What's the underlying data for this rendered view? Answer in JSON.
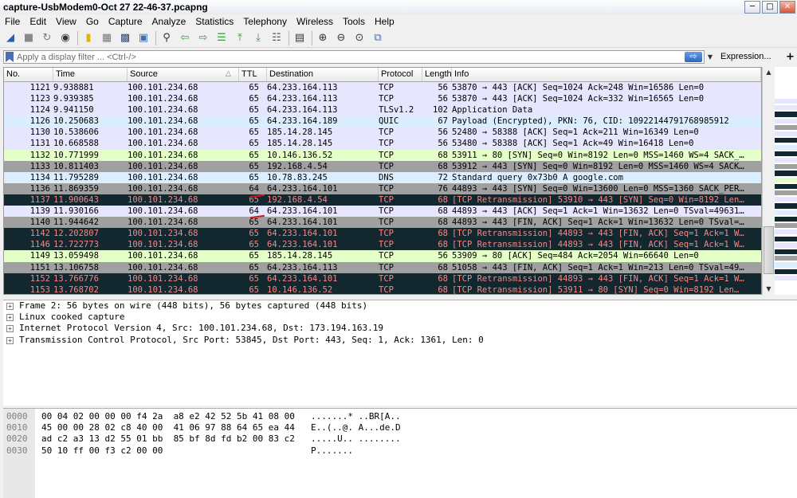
{
  "window": {
    "title": "capture-UsbModem0-Oct 27 22-46-37.pcapng",
    "btn_min": "─",
    "btn_max": "□",
    "btn_close": "✕"
  },
  "menu": [
    "File",
    "Edit",
    "View",
    "Go",
    "Capture",
    "Analyze",
    "Statistics",
    "Telephony",
    "Wireless",
    "Tools",
    "Help"
  ],
  "toolbar": {
    "groups": [
      [
        {
          "name": "start-capture-icon",
          "glyph": "◢",
          "color": "#2a5bb5"
        },
        {
          "name": "stop-capture-icon",
          "glyph": "■",
          "color": "#8a8a8a"
        },
        {
          "name": "restart-capture-icon",
          "glyph": "↻",
          "color": "#7a7a7a"
        },
        {
          "name": "capture-options-icon",
          "glyph": "◉",
          "color": "#333333"
        }
      ],
      [
        {
          "name": "open-file-icon",
          "glyph": "▮",
          "color": "#e3b400"
        },
        {
          "name": "save-file-icon",
          "glyph": "▦",
          "color": "#777777"
        },
        {
          "name": "close-file-icon",
          "glyph": "▩",
          "color": "#304a77"
        },
        {
          "name": "reload-file-icon",
          "glyph": "▣",
          "color": "#3f6fb0"
        }
      ],
      [
        {
          "name": "find-packet-icon",
          "glyph": "⚲",
          "color": "#333333"
        },
        {
          "name": "go-back-icon",
          "glyph": "⇦",
          "color": "#3a9a3a"
        },
        {
          "name": "go-forward-icon",
          "glyph": "⇨",
          "color": "#3a9a3a"
        },
        {
          "name": "go-to-packet-icon",
          "glyph": "☰",
          "color": "#3a9a3a"
        },
        {
          "name": "go-first-icon",
          "glyph": "⤒",
          "color": "#3a9a3a"
        },
        {
          "name": "go-last-icon",
          "glyph": "⤓",
          "color": "#3a9a3a"
        },
        {
          "name": "autoscroll-icon",
          "glyph": "☷",
          "color": "#555555"
        }
      ],
      [
        {
          "name": "colorize-icon",
          "glyph": "▤",
          "color": "#333333"
        }
      ],
      [
        {
          "name": "zoom-in-icon",
          "glyph": "⊕",
          "color": "#333333"
        },
        {
          "name": "zoom-out-icon",
          "glyph": "⊖",
          "color": "#333333"
        },
        {
          "name": "zoom-normal-icon",
          "glyph": "⊙",
          "color": "#333333"
        },
        {
          "name": "resize-columns-icon",
          "glyph": "⧉",
          "color": "#3f6fb0"
        }
      ]
    ]
  },
  "filter": {
    "placeholder": "Apply a display filter ... <Ctrl-/>",
    "apply_glyph": "⇨",
    "dropdown_glyph": "▼",
    "expression_label": "Expression...",
    "plus": "+"
  },
  "columns": [
    {
      "key": "no",
      "label": "No."
    },
    {
      "key": "time",
      "label": "Time"
    },
    {
      "key": "source",
      "label": "Source"
    },
    {
      "key": "ttl",
      "label": "TTL"
    },
    {
      "key": "destination",
      "label": "Destination"
    },
    {
      "key": "protocol",
      "label": "Protocol"
    },
    {
      "key": "length",
      "label": "Length"
    },
    {
      "key": "info",
      "label": "Info"
    }
  ],
  "sort_arrow": "△",
  "colors": {
    "tcp": "#e7e6ff",
    "udp": "#daeeff",
    "syn": "#a0a0a0",
    "fin": "#a0a0a0",
    "bad": "#12272e",
    "bad_text": "#f78787",
    "http": "#e4ffc7"
  },
  "packets": [
    {
      "no": "1121",
      "time": "9.938881",
      "source": "100.101.234.68",
      "ttl": "65",
      "destination": "64.233.164.113",
      "protocol": "TCP",
      "length": "56",
      "info": "53870 → 443 [ACK] Seq=1024 Ack=248 Win=16586 Len=0",
      "style": "tcp"
    },
    {
      "no": "1123",
      "time": "9.939385",
      "source": "100.101.234.68",
      "ttl": "65",
      "destination": "64.233.164.113",
      "protocol": "TCP",
      "length": "56",
      "info": "53870 → 443 [ACK] Seq=1024 Ack=332 Win=16565 Len=0",
      "style": "tcp"
    },
    {
      "no": "1124",
      "time": "9.941150",
      "source": "100.101.234.68",
      "ttl": "65",
      "destination": "64.233.164.113",
      "protocol": "TLSv1.2",
      "length": "102",
      "info": "Application Data",
      "style": "tcp"
    },
    {
      "no": "1126",
      "time": "10.250683",
      "source": "100.101.234.68",
      "ttl": "65",
      "destination": "64.233.164.189",
      "protocol": "QUIC",
      "length": "67",
      "info": "Payload (Encrypted), PKN: 76, CID: 10922144791768985912",
      "style": "udp"
    },
    {
      "no": "1130",
      "time": "10.538606",
      "source": "100.101.234.68",
      "ttl": "65",
      "destination": "185.14.28.145",
      "protocol": "TCP",
      "length": "56",
      "info": "52480 → 58388 [ACK] Seq=1 Ack=211 Win=16349 Len=0",
      "style": "tcp"
    },
    {
      "no": "1131",
      "time": "10.668588",
      "source": "100.101.234.68",
      "ttl": "65",
      "destination": "185.14.28.145",
      "protocol": "TCP",
      "length": "56",
      "info": "53480 → 58388 [ACK] Seq=1 Ack=49 Win=16418 Len=0",
      "style": "tcp"
    },
    {
      "no": "1132",
      "time": "10.771999",
      "source": "100.101.234.68",
      "ttl": "65",
      "destination": "10.146.136.52",
      "protocol": "TCP",
      "length": "68",
      "info": "53911 → 80 [SYN] Seq=0 Win=8192 Len=0 MSS=1460 WS=4 SACK_…",
      "style": "http"
    },
    {
      "no": "1133",
      "time": "10.811403",
      "source": "100.101.234.68",
      "ttl": "65",
      "destination": "192.168.4.54",
      "protocol": "TCP",
      "length": "68",
      "info": "53912 → 443 [SYN] Seq=0 Win=8192 Len=0 MSS=1460 WS=4 SACK…",
      "style": "syn"
    },
    {
      "no": "1134",
      "time": "11.795289",
      "source": "100.101.234.68",
      "ttl": "65",
      "destination": "10.78.83.245",
      "protocol": "DNS",
      "length": "72",
      "info": "Standard query 0x73b0 A google.com",
      "style": "udp"
    },
    {
      "no": "1136",
      "time": "11.869359",
      "source": "100.101.234.68",
      "ttl": "64",
      "destination": "64.233.164.101",
      "protocol": "TCP",
      "length": "76",
      "info": "44893 → 443 [SYN] Seq=0 Win=13600 Len=0 MSS=1360 SACK_PER…",
      "style": "syn"
    },
    {
      "no": "1137",
      "time": "11.900643",
      "source": "100.101.234.68",
      "ttl": "65",
      "destination": "192.168.4.54",
      "protocol": "TCP",
      "length": "68",
      "info": "[TCP Retransmission] 53910 → 443 [SYN] Seq=0 Win=8192 Len…",
      "style": "bad"
    },
    {
      "no": "1139",
      "time": "11.930166",
      "source": "100.101.234.68",
      "ttl": "64",
      "destination": "64.233.164.101",
      "protocol": "TCP",
      "length": "68",
      "info": "44893 → 443 [ACK] Seq=1 Ack=1 Win=13632 Len=0 TSval=49631…",
      "style": "tcp"
    },
    {
      "no": "1140",
      "time": "11.944642",
      "source": "100.101.234.68",
      "ttl": "65",
      "destination": "64.233.164.101",
      "protocol": "TCP",
      "length": "68",
      "info": "44893 → 443 [FIN, ACK] Seq=1 Ack=1 Win=13632 Len=0 TSval=…",
      "style": "fin"
    },
    {
      "no": "1142",
      "time": "12.202807",
      "source": "100.101.234.68",
      "ttl": "65",
      "destination": "64.233.164.101",
      "protocol": "TCP",
      "length": "68",
      "info": "[TCP Retransmission] 44893 → 443 [FIN, ACK] Seq=1 Ack=1 W…",
      "style": "bad"
    },
    {
      "no": "1146",
      "time": "12.722773",
      "source": "100.101.234.68",
      "ttl": "65",
      "destination": "64.233.164.101",
      "protocol": "TCP",
      "length": "68",
      "info": "[TCP Retransmission] 44893 → 443 [FIN, ACK] Seq=1 Ack=1 W…",
      "style": "bad"
    },
    {
      "no": "1149",
      "time": "13.059498",
      "source": "100.101.234.68",
      "ttl": "65",
      "destination": "185.14.28.145",
      "protocol": "TCP",
      "length": "56",
      "info": "53909 → 80 [ACK] Seq=484 Ack=2054 Win=66640 Len=0",
      "style": "http"
    },
    {
      "no": "1151",
      "time": "13.106758",
      "source": "100.101.234.68",
      "ttl": "65",
      "destination": "64.233.164.113",
      "protocol": "TCP",
      "length": "68",
      "info": "51058 → 443 [FIN, ACK] Seq=1 Ack=1 Win=213 Len=0 TSval=49…",
      "style": "fin"
    },
    {
      "no": "1152",
      "time": "13.766776",
      "source": "100.101.234.68",
      "ttl": "65",
      "destination": "64.233.164.101",
      "protocol": "TCP",
      "length": "68",
      "info": "[TCP Retransmission] 44893 → 443 [FIN, ACK] Seq=1 Ack=1 W…",
      "style": "bad"
    },
    {
      "no": "1153",
      "time": "13.768702",
      "source": "100.101.234.68",
      "ttl": "65",
      "destination": "10.146.136.52",
      "protocol": "TCP",
      "length": "68",
      "info": "[TCP Retransmission] 53911 → 80 [SYN] Seq=0 Win=8192 Len…",
      "style": "bad"
    }
  ],
  "scroll": {
    "up": "▲",
    "down": "▼"
  },
  "minimap": [
    "#e7e6ff",
    "#e7e6ff",
    "#12272e",
    "#e7e6ff",
    "#a0a0a0",
    "#e7e6ff",
    "#12272e",
    "#daeeff",
    "#12272e",
    "#e7e6ff",
    "#a0a0a0",
    "#12272e",
    "#e4ffc7",
    "#12272e",
    "#a0a0a0",
    "#e7e6ff",
    "#12272e",
    "#daeeff",
    "#12272e",
    "#a0a0a0",
    "#e7e6ff",
    "#12272e",
    "#e7e6ff",
    "#12272e",
    "#a0a0a0",
    "#daeeff",
    "#12272e",
    "#e7e6ff"
  ],
  "details": {
    "expander": "+",
    "items": [
      "Frame 2: 56 bytes on wire (448 bits), 56 bytes captured (448 bits)",
      "Linux cooked capture",
      "Internet Protocol Version 4, Src: 100.101.234.68, Dst: 173.194.163.19",
      "Transmission Control Protocol, Src Port: 53845, Dst Port: 443, Seq: 1, Ack: 1361, Len: 0"
    ]
  },
  "hex": [
    {
      "offset": "0000",
      "bytes": "00 04 02 00 00 00 f4 2a  a8 e2 42 52 5b 41 08 00",
      "ascii": ".......* ..BR[A.."
    },
    {
      "offset": "0010",
      "bytes": "45 00 00 28 02 c8 40 00  41 06 97 88 64 65 ea 44",
      "ascii": "E..(..@. A...de.D"
    },
    {
      "offset": "0020",
      "bytes": "ad c2 a3 13 d2 55 01 bb  85 bf 8d fd b2 00 83 c2",
      "ascii": ".....U.. ........"
    },
    {
      "offset": "0030",
      "bytes": "50 10 ff 00 f3 c2 00 00",
      "ascii": "P......."
    }
  ]
}
